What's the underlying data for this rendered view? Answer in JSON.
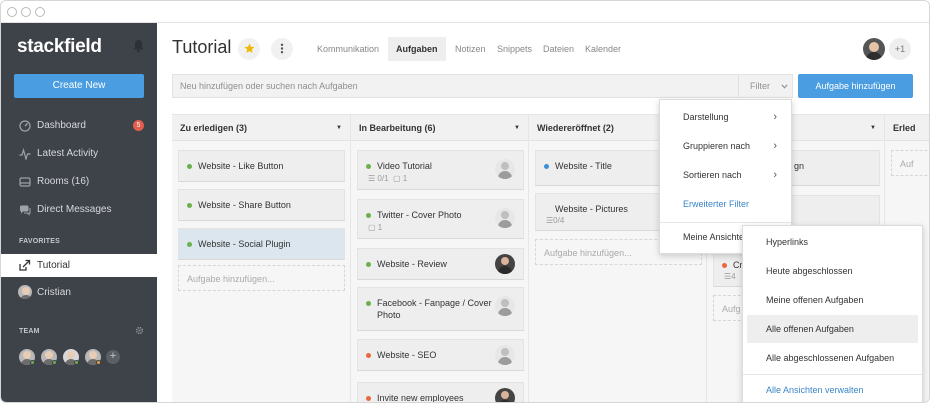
{
  "app": {
    "logo_text": "stackfield"
  },
  "sidebar": {
    "create_label": "Create New",
    "items": [
      {
        "label": "Dashboard",
        "icon": "dashboard-icon",
        "badge": "5"
      },
      {
        "label": "Latest Activity",
        "icon": "activity-icon"
      },
      {
        "label": "Rooms (16)",
        "icon": "rooms-icon"
      },
      {
        "label": "Direct Messages",
        "icon": "messages-icon"
      }
    ],
    "favorites_label": "FAVORITES",
    "favorites": [
      {
        "label": "Tutorial",
        "icon": "room-link-icon",
        "active": true
      },
      {
        "label": "Cristian",
        "icon": "avatar"
      }
    ],
    "team_label": "TEAM",
    "team_settings_icon": "gear-icon",
    "add_member_icon": "plus-icon"
  },
  "header": {
    "title": "Tutorial",
    "star_icon": "star-icon",
    "more_icon": "more-vertical-icon",
    "tabs": [
      {
        "label": "Kommunikation"
      },
      {
        "label": "Aufgaben",
        "active": true
      },
      {
        "label": "Notizen"
      },
      {
        "label": "Snippets"
      },
      {
        "label": "Dateien"
      },
      {
        "label": "Kalender"
      }
    ],
    "members_more": "+1"
  },
  "toolbar": {
    "search_placeholder": "Neu hinzufügen oder suchen nach Aufgaben",
    "filter_label": "Filter",
    "add_task_label": "Aufgabe hinzufügen"
  },
  "columns": [
    {
      "title": "Zu erledigen (3)",
      "cards": [
        {
          "title": "Website - Like Button",
          "status_color": "#6ab04c"
        },
        {
          "title": "Website - Share Button",
          "status_color": "#6ab04c"
        },
        {
          "title": "Website - Social Plugin",
          "status_color": "#6ab04c",
          "selected": true
        }
      ],
      "add_label": "Aufgabe hinzufügen..."
    },
    {
      "title": "In Bearbeitung (6)",
      "cards": [
        {
          "title": "Video Tutorial",
          "status_color": "#6ab04c",
          "checklist": "0/1",
          "comments": "1"
        },
        {
          "title": "Twitter - Cover Photo",
          "status_color": "#6ab04c",
          "comments": "1"
        },
        {
          "title": "Website - Review",
          "status_color": "#6ab04c"
        },
        {
          "title": "Facebook - Fanpage / Cover Photo",
          "status_color": "#6ab04c"
        },
        {
          "title": "Website - SEO",
          "status_color": "#e8683f"
        },
        {
          "title": "Invite new employees",
          "status_color": "#e8683f"
        }
      ]
    },
    {
      "title": "Wiedereröffnet (2)",
      "cards": [
        {
          "title": "Website - Title",
          "status_color": "#3d8fd6"
        },
        {
          "title": "Website - Pictures",
          "checklist": "0/4"
        }
      ],
      "add_label": "Aufgabe hinzufügen..."
    },
    {
      "title": "",
      "cards": [
        {
          "title": "gn"
        },
        {
          "title": ""
        },
        {
          "title": "Cre",
          "status_color": "#e8683f",
          "meta": "4"
        }
      ],
      "add_label": "Aufg"
    },
    {
      "title": "Erled",
      "add_label": "Auf"
    }
  ],
  "filter_menu": {
    "items": [
      {
        "label": "Darstellung",
        "arrow": "›"
      },
      {
        "label": "Gruppieren nach",
        "arrow": "›"
      },
      {
        "label": "Sortieren nach",
        "arrow": "›"
      },
      {
        "label": "Erweiterter Filter",
        "link": true
      },
      {
        "label": "Meine Ansichte"
      }
    ]
  },
  "views_menu": {
    "items": [
      {
        "label": "Hyperlinks"
      },
      {
        "label": "Heute abgeschlossen"
      },
      {
        "label": "Meine offenen Aufgaben"
      },
      {
        "label": "Alle offenen Aufgaben",
        "highlighted": true
      },
      {
        "label": "Alle abgeschlossenen Aufgaben"
      }
    ],
    "manage_label": "Alle Ansichten verwalten"
  },
  "colors": {
    "sidebar_bg": "#3e4249",
    "accent": "#4a9de0",
    "link": "#3a86c8",
    "status_green": "#6ab04c",
    "status_orange": "#e8683f",
    "status_blue": "#3d8fd6",
    "badge_red": "#e35d4c"
  }
}
